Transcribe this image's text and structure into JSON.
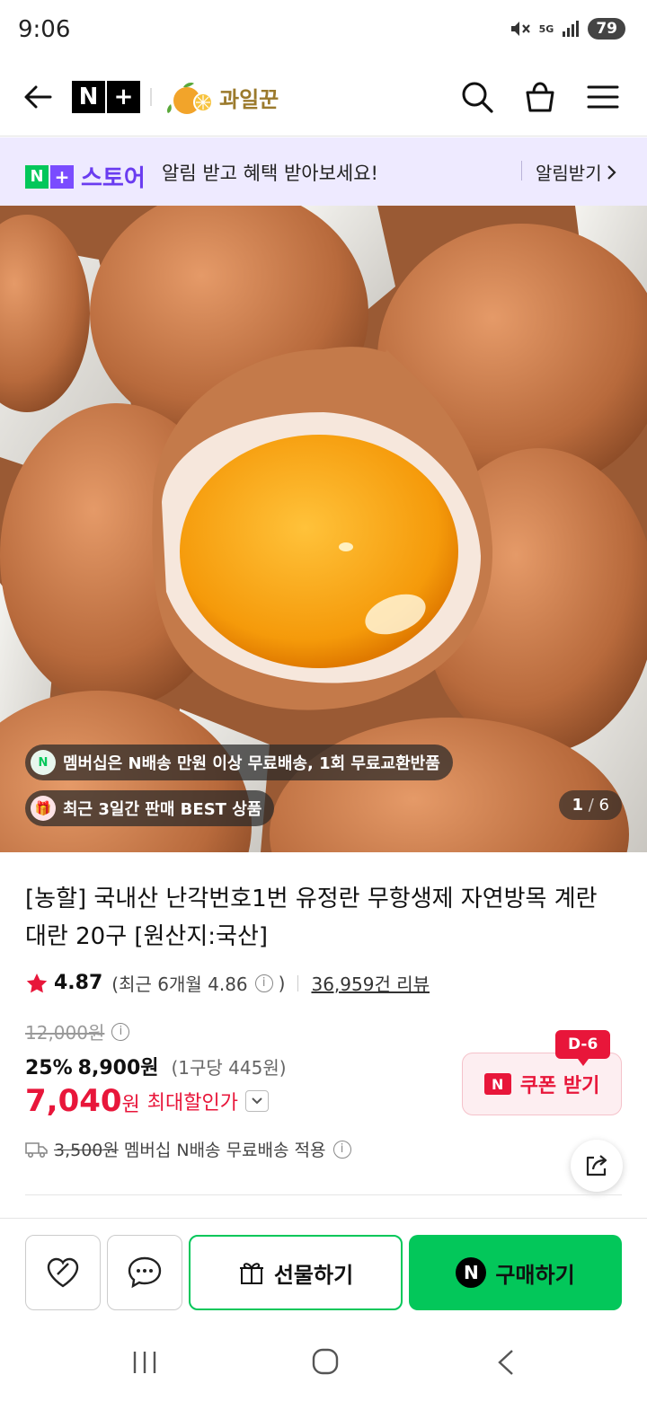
{
  "status_bar": {
    "time": "9:06",
    "network": "5G",
    "battery": "79"
  },
  "header": {
    "logo_n": "N",
    "logo_plus": "+",
    "store_name": "과일꾼"
  },
  "banner": {
    "logo_n": "N",
    "logo_plus": "+",
    "store_label": "스토어",
    "message": "알림 받고 혜택 받아보세요!",
    "action_label": "알림받기"
  },
  "gallery": {
    "badges": [
      {
        "icon_text": "N",
        "text": "멤버십은 N배송 만원 이상 무료배송, 1회 무료교환반품"
      },
      {
        "icon_text": "🎁",
        "text": "최근 3일간 판매 BEST 상품"
      }
    ],
    "current": "1",
    "total": "6"
  },
  "product": {
    "title": "[농할] 국내산 난각번호1번 유정란 무항생제 자연방목 계란 대란 20구 [원산지:국산]",
    "rating": "4.87",
    "rating_recent_prefix": "(최근 6개월 4.86",
    "rating_recent_suffix": ")",
    "review_count": "36,959건 리뷰",
    "original_price": "12,000원",
    "discount_rate": "25%",
    "sale_price": "8,900원",
    "unit_price": "(1구당 445원)",
    "final_price_number": "7,040",
    "final_price_unit": "원",
    "final_price_label": "최대할인가",
    "coupon_dday": "D-6",
    "coupon_n": "N",
    "coupon_label": "쿠폰 받기",
    "shipping_original": "3,500원",
    "shipping_text": "멤버십 N배송 무료배송 적용"
  },
  "actions": {
    "gift_label": "선물하기",
    "buy_n": "N",
    "buy_label": "구매하기"
  },
  "colors": {
    "naver_green": "#03c75a",
    "store_purple": "#6a3cf0",
    "sale_red": "#e8163a",
    "banner_bg": "#eeeaff"
  }
}
